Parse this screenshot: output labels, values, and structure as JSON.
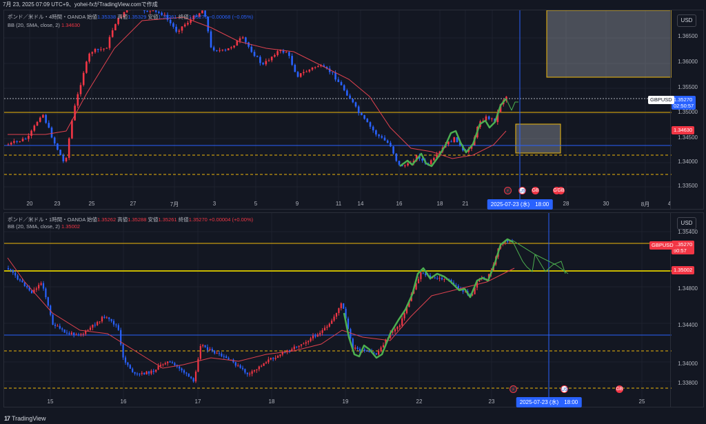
{
  "caption": "7月 23, 2025 07:09 UTC+9、yohei-fxがTradingView.comで作成",
  "brand": "TradingView",
  "brand_logo": "17",
  "colors": {
    "up": "#f23645",
    "down": "#2962ff",
    "bb": "#e0424f",
    "level": "#f0b90b",
    "wave": "#4caf50",
    "blueline": "#2962ff"
  },
  "pane1": {
    "symbol": "ポンド／米ドル・4時間・OANDA",
    "open_label": "始値",
    "open": "1.35338",
    "high_label": "高値",
    "high": "1.35329",
    "low_label": "安値",
    "low": "1.35261",
    "close_label": "終値",
    "close": "1.35270",
    "change": "−0.00068 (−0.05%)",
    "indicator": "BB (20, SMA, close, 2)",
    "indicator_value": "1.34630",
    "currency": "USD",
    "price_labels": [
      "1.36500",
      "1.36000",
      "1.35500",
      "1.35000",
      "1.34500",
      "1.34000",
      "1.33500"
    ],
    "pair_tag": "GBPUSD",
    "last_price": "1.35270",
    "countdown": "02:50:57",
    "bb_tag": "1.34630",
    "time_labels": [
      "20",
      "23",
      "25",
      "27",
      "7月",
      "3",
      "5",
      "9",
      "11",
      "14",
      "16",
      "18",
      "21",
      "23",
      "28",
      "30",
      "8月",
      "4"
    ],
    "cross_date": "2025-07-23 (水)　18:00",
    "events": [
      {
        "icon": "bolt-icon",
        "glyph": "⚡"
      },
      {
        "icon": "us-flag-icon",
        "glyph": "US"
      },
      {
        "icon": "gb-flag-icon",
        "glyph": "GB"
      },
      {
        "icon": "gb-flag-icon",
        "glyph": "GB"
      },
      {
        "icon": "gb-flag-icon",
        "glyph": "GB"
      }
    ]
  },
  "pane2": {
    "symbol": "ポンド／米ドル・1時間・OANDA",
    "open_label": "始値",
    "open": "1.35262",
    "high_label": "高値",
    "high": "1.35288",
    "low_label": "安値",
    "low": "1.35261",
    "close_label": "終値",
    "close": "1.35270",
    "change": "+0.00004 (+0.00%)",
    "indicator": "BB (20, SMA, close, 2)",
    "indicator_value": "1.35002",
    "currency": "USD",
    "price_labels": [
      "1.35400",
      "1.34800",
      "1.34400",
      "1.34000",
      "1.33800"
    ],
    "pair_tag": "GBPUSD",
    "last_price": "1.35270",
    "countdown": "50:57",
    "bb_tag": "1.35002",
    "time_labels": [
      "15",
      "16",
      "17",
      "18",
      "19",
      "22",
      "23",
      "25"
    ],
    "cross_date": "2025-07-23 (水)　18:00",
    "events": [
      {
        "icon": "bolt-icon",
        "glyph": "⚡"
      },
      {
        "icon": "us-flag-icon",
        "glyph": "US"
      },
      {
        "icon": "gb-flag-icon",
        "glyph": "GB"
      }
    ]
  }
}
